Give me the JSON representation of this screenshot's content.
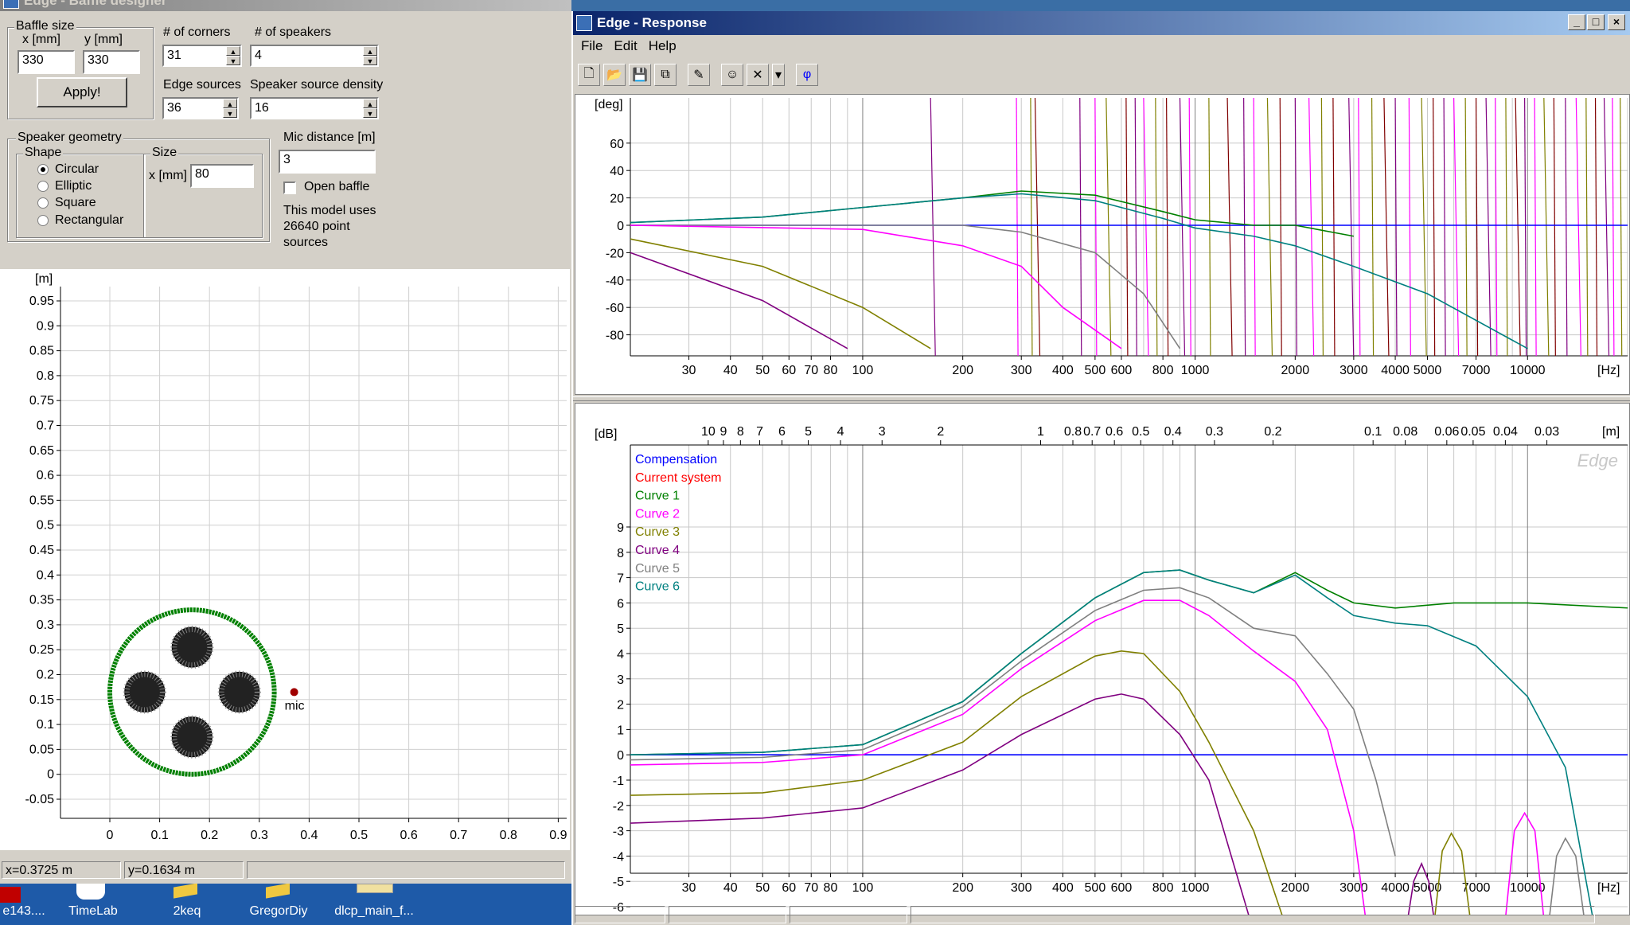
{
  "colors": {
    "compensation": "#0000ff",
    "current_system": "#ff0000",
    "curve1": "#008000",
    "curve2": "#ff00ff",
    "curve3": "#808000",
    "curve4": "#800080",
    "curve5": "#808080",
    "curve6": "#008080",
    "baffle_outline": "#008000"
  },
  "baffle_window": {
    "title": "Edge - Baffle designer",
    "baffle_size": {
      "group_label": "Baffle size",
      "x_label": "x [mm]",
      "y_label": "y [mm]",
      "x_value": "330",
      "y_value": "330",
      "apply_label": "Apply!"
    },
    "corners": {
      "label": "# of corners",
      "value": "31"
    },
    "speakers": {
      "label": "# of speakers",
      "value": "4"
    },
    "edge_sources": {
      "label": "Edge sources",
      "value": "36"
    },
    "speaker_density": {
      "label": "Speaker source density",
      "value": "16"
    },
    "speaker_geometry": {
      "group_label": "Speaker geometry",
      "shape_label": "Shape",
      "shapes": [
        "Circular",
        "Elliptic",
        "Square",
        "Rectangular"
      ],
      "selected_shape": "Circular",
      "size_label": "Size",
      "size_x_label": "x [mm]",
      "size_x_value": "80"
    },
    "mic_distance": {
      "label": "Mic distance [m]",
      "value": "3"
    },
    "open_baffle": {
      "label": "Open baffle",
      "checked": false
    },
    "model_info": [
      "This model uses",
      "26640 point",
      "sources"
    ],
    "plot": {
      "y_unit": "[m]",
      "y_ticks": [
        "0.95",
        "0.9",
        "0.85",
        "0.8",
        "0.75",
        "0.7",
        "0.65",
        "0.6",
        "0.55",
        "0.5",
        "0.45",
        "0.4",
        "0.35",
        "0.3",
        "0.25",
        "0.2",
        "0.15",
        "0.1",
        "0.05",
        "0",
        "-0.05"
      ],
      "x_ticks": [
        "0",
        "0.1",
        "0.2",
        "0.3",
        "0.4",
        "0.5",
        "0.6",
        "0.7",
        "0.8",
        "0.9"
      ],
      "mic_label": "mic",
      "baffle_center_m": [
        0.165,
        0.165
      ],
      "baffle_radius_m": 0.165,
      "speakers_m": [
        [
          0.165,
          0.255
        ],
        [
          0.07,
          0.165
        ],
        [
          0.26,
          0.165
        ],
        [
          0.165,
          0.075
        ]
      ],
      "speaker_radius_m": 0.04,
      "mic_m": [
        0.37,
        0.165
      ]
    },
    "status": {
      "x": "x=0.3725 m",
      "y": "y=0.1634 m"
    }
  },
  "response_window": {
    "title": "Edge - Response",
    "menu": [
      "File",
      "Edit",
      "Help"
    ],
    "toolbar_icons": [
      "new-icon",
      "open-icon",
      "save-icon",
      "copy-icon",
      "pencil-icon",
      "person-icon",
      "delete-icon",
      "dropdown-icon",
      "phase-icon"
    ],
    "phi_symbol": "φ",
    "phase_plot": {
      "y_unit": "[deg]",
      "y_ticks": [
        "60",
        "40",
        "20",
        "0",
        "-20",
        "-40",
        "-60",
        "-80"
      ],
      "x_ticks": [
        "30",
        "40",
        "50",
        "60",
        "70",
        "80",
        "100",
        "200",
        "300",
        "400",
        "500",
        "600",
        "800",
        "1000",
        "2000",
        "3000",
        "4000",
        "5000",
        "7000",
        "10000"
      ],
      "x_unit": "[Hz]"
    },
    "spl_plot": {
      "y_unit": "[dB]",
      "y_ticks": [
        "9",
        "8",
        "7",
        "6",
        "5",
        "4",
        "3",
        "2",
        "1",
        "0",
        "-1",
        "-2",
        "-3",
        "-4",
        "-5",
        "-6"
      ],
      "x_ticks": [
        "30",
        "40",
        "50",
        "60",
        "70",
        "80",
        "100",
        "200",
        "300",
        "400",
        "500",
        "600",
        "800",
        "1000",
        "2000",
        "3000",
        "4000",
        "5000",
        "7000",
        "10000"
      ],
      "x_unit": "[Hz]",
      "top_ticks": [
        "10",
        "9",
        "8",
        "7",
        "6",
        "5",
        "4",
        "3",
        "2",
        "1",
        "0.8",
        "0.7",
        "0.6",
        "0.5",
        "0.4",
        "0.3",
        "0.2",
        "0.1",
        "0.08",
        "0.06",
        "0.05",
        "0.04",
        "0.03"
      ],
      "top_unit": "[m]",
      "watermark": "Edge",
      "legend": [
        "Compensation",
        "Current system",
        "Curve 1",
        "Curve 2",
        "Curve 3",
        "Curve 4",
        "Curve 5",
        "Curve 6"
      ]
    }
  },
  "chart_data": [
    {
      "type": "line",
      "title": "",
      "xlabel": "[Hz]",
      "ylabel": "[dB]",
      "xscale": "log",
      "xlim": [
        20,
        20000
      ],
      "ylim": [
        -7,
        10
      ],
      "grid": true,
      "legend_position": "top-left",
      "series": [
        {
          "name": "Compensation",
          "x": [
            20,
            20000
          ],
          "values": [
            0,
            0
          ]
        },
        {
          "name": "Curve 1",
          "x": [
            20,
            50,
            100,
            200,
            300,
            500,
            700,
            900,
            1100,
            1500,
            2000,
            2500,
            3000,
            4000,
            6000,
            10000,
            20000
          ],
          "values": [
            0,
            0.1,
            0.4,
            2.1,
            4.0,
            6.2,
            7.2,
            7.3,
            6.9,
            6.4,
            7.2,
            6.5,
            6.0,
            5.8,
            6.0,
            6.0,
            5.8
          ]
        },
        {
          "name": "Curve 2",
          "x": [
            20,
            50,
            100,
            200,
            300,
            500,
            700,
            900,
            1100,
            1500,
            2000,
            2500,
            3000,
            3300
          ],
          "values": [
            -0.4,
            -0.3,
            0,
            1.6,
            3.4,
            5.3,
            6.1,
            6.1,
            5.5,
            4.1,
            2.9,
            1,
            -3,
            -7
          ]
        },
        {
          "name": "Curve 3",
          "x": [
            20,
            50,
            100,
            200,
            300,
            500,
            600,
            700,
            900,
            1100,
            1500,
            1900
          ],
          "values": [
            -1.6,
            -1.5,
            -1.0,
            0.5,
            2.3,
            3.9,
            4.1,
            4.0,
            2.5,
            0.5,
            -3,
            -7
          ]
        },
        {
          "name": "Curve 4",
          "x": [
            20,
            50,
            100,
            200,
            300,
            500,
            600,
            700,
            900,
            1100,
            1500
          ],
          "values": [
            -2.7,
            -2.5,
            -2.1,
            -0.6,
            0.8,
            2.2,
            2.4,
            2.2,
            0.8,
            -1.0,
            -7
          ]
        },
        {
          "name": "Curve 5",
          "x": [
            20,
            50,
            100,
            200,
            300,
            500,
            700,
            900,
            1100,
            1500,
            2000,
            2500,
            3000,
            3500,
            4000
          ],
          "values": [
            -0.2,
            -0.1,
            0.2,
            1.9,
            3.7,
            5.7,
            6.5,
            6.6,
            6.2,
            5.0,
            4.7,
            3.2,
            1.8,
            -1,
            -4
          ]
        },
        {
          "name": "Curve 6",
          "x": [
            20,
            50,
            100,
            200,
            300,
            500,
            700,
            900,
            1100,
            1500,
            2000,
            2500,
            3000,
            4000,
            5000,
            7000,
            10000,
            13000,
            16000
          ],
          "values": [
            0,
            0.1,
            0.4,
            2.1,
            4.0,
            6.2,
            7.2,
            7.3,
            6.9,
            6.4,
            7.1,
            6.2,
            5.5,
            5.2,
            5.1,
            4.3,
            2.3,
            -0.5,
            -7
          ]
        }
      ]
    },
    {
      "type": "line",
      "title": "",
      "xlabel": "[Hz]",
      "ylabel": "[deg]",
      "xscale": "log",
      "xlim": [
        20,
        20000
      ],
      "ylim": [
        -90,
        90
      ],
      "grid": true,
      "series": [
        {
          "name": "Compensation",
          "x": [
            20,
            20000
          ],
          "values": [
            0,
            0
          ]
        },
        {
          "name": "Curve 1",
          "x": [
            20,
            50,
            100,
            200,
            300,
            500,
            800,
            1000,
            1500,
            2000,
            3000
          ],
          "values": [
            2,
            6,
            13,
            20,
            25,
            22,
            10,
            4,
            0,
            0,
            -8
          ]
        },
        {
          "name": "Curve 6",
          "x": [
            20,
            50,
            100,
            200,
            300,
            500,
            800,
            1000,
            1500,
            2000,
            3000,
            5000,
            10000
          ],
          "values": [
            2,
            6,
            13,
            20,
            23,
            18,
            5,
            -2,
            -8,
            -15,
            -30,
            -50,
            -90
          ]
        },
        {
          "name": "Curve 5",
          "x": [
            20,
            100,
            200,
            300,
            500,
            700,
            900
          ],
          "values": [
            0,
            0,
            0,
            -5,
            -20,
            -50,
            -90
          ]
        },
        {
          "name": "Curve 2",
          "x": [
            20,
            100,
            200,
            300,
            400,
            600
          ],
          "values": [
            0,
            -3,
            -15,
            -30,
            -60,
            -90
          ]
        },
        {
          "name": "Curve 3",
          "x": [
            20,
            50,
            100,
            160
          ],
          "values": [
            -10,
            -30,
            -60,
            -90
          ]
        },
        {
          "name": "Curve 4",
          "x": [
            20,
            50,
            90
          ],
          "values": [
            -20,
            -55,
            -90
          ]
        }
      ]
    }
  ]
}
